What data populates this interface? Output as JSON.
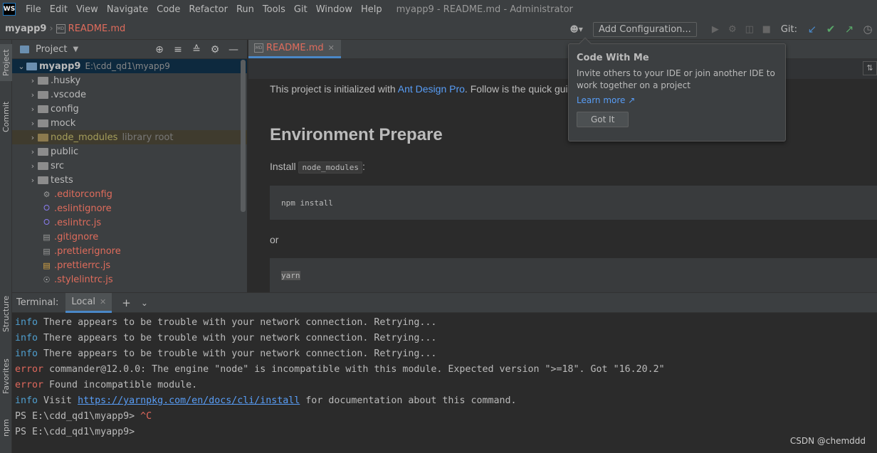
{
  "menubar": {
    "logo": "WS",
    "items": [
      "File",
      "Edit",
      "View",
      "Navigate",
      "Code",
      "Refactor",
      "Run",
      "Tools",
      "Git",
      "Window",
      "Help"
    ],
    "window_title": "myapp9 - README.md - Administrator"
  },
  "navbar": {
    "project": "myapp9",
    "file": "README.md",
    "add_configuration": "Add Configuration...",
    "git_label": "Git:"
  },
  "left_strip": {
    "tabs": [
      "Project",
      "Commit",
      "Structure",
      "Favorites",
      "npm"
    ]
  },
  "project_panel": {
    "title": "Project",
    "root": {
      "name": "myapp9",
      "path": "E:\\cdd_qd1\\myapp9"
    },
    "folders": [
      ".husky",
      ".vscode",
      "config",
      "mock",
      "node_modules",
      "public",
      "src",
      "tests"
    ],
    "node_modules_hint": "library root",
    "files": [
      ".editorconfig",
      ".eslintignore",
      ".eslintrc.js",
      ".gitignore",
      ".prettierignore",
      ".prettierrc.js",
      ".stylelintrc.js"
    ]
  },
  "editor": {
    "tab_label": "README.md",
    "intro_text": "This project is initialized with ",
    "intro_link": "Ant Design Pro",
    "intro_after": ". Follow is the quick gui",
    "heading": "Environment Prepare",
    "install_text": "Install ",
    "install_code": "node_modules",
    "install_colon": ":",
    "code1": "npm install",
    "or_text": "or",
    "code2": "yarn"
  },
  "popup": {
    "title": "Code With Me",
    "text": "Invite others to your IDE or join another IDE to work together on a project",
    "link": "Learn more ↗",
    "button": "Got It"
  },
  "terminal": {
    "title": "Terminal:",
    "tab": "Local",
    "lines": [
      {
        "kind": "info",
        "prefix": "info",
        "text": " There appears to be trouble with your network connection. Retrying..."
      },
      {
        "kind": "info",
        "prefix": "info",
        "text": " There appears to be trouble with your network connection. Retrying..."
      },
      {
        "kind": "info",
        "prefix": "info",
        "text": " There appears to be trouble with your network connection. Retrying..."
      },
      {
        "kind": "error",
        "prefix": "error",
        "text": " commander@12.0.0: The engine \"node\" is incompatible with this module. Expected version \">=18\". Got \"16.20.2\""
      },
      {
        "kind": "error",
        "prefix": "error",
        "text": " Found incompatible module."
      }
    ],
    "visit_prefix": "info",
    "visit_text": " Visit ",
    "visit_url": "https://yarnpkg.com/en/docs/cli/install",
    "visit_after": " for documentation about this command.",
    "prompt1": "PS E:\\cdd_qd1\\myapp9> ",
    "prompt1_ctrl": "^C",
    "prompt2": "PS E:\\cdd_qd1\\myapp9>"
  },
  "watermark": "CSDN @chemddd",
  "colors": {
    "accent": "#4a88c7",
    "error": "#e0685c",
    "info": "#4f9fcf",
    "link": "#589df6",
    "modified_file": "#e06c5c"
  }
}
